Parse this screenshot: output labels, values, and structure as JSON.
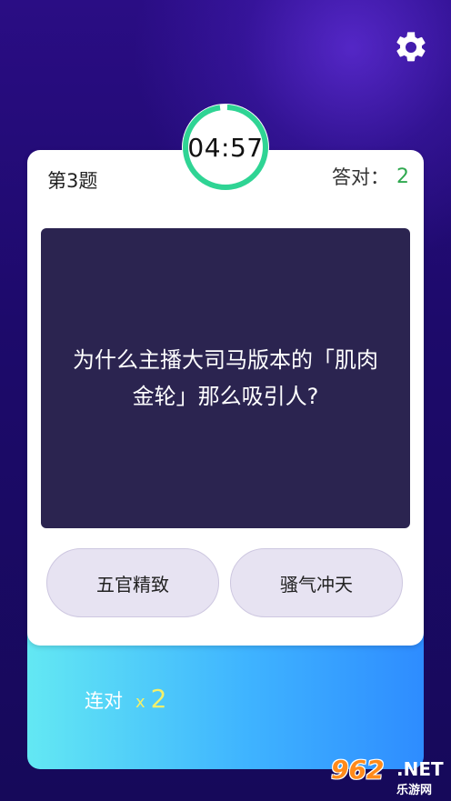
{
  "settings": {
    "icon": "gear-icon"
  },
  "timer": {
    "value": "04:57",
    "ring_color": "#2fd494"
  },
  "header": {
    "question_number": "第3题",
    "score_label": "答对：",
    "score_value": "2"
  },
  "question": {
    "text": "为什么主播大司马版本的「肌肉金轮」那么吸引人?"
  },
  "options": [
    {
      "label": "五官精致"
    },
    {
      "label": "骚气冲天"
    }
  ],
  "streak": {
    "label": "连对",
    "multiplier_prefix": "x",
    "value": "2"
  },
  "watermark": {
    "logo": "962",
    "suffix": ".NET",
    "sub": "乐游网"
  },
  "colors": {
    "background": "#1d0a6b",
    "question_bg": "#2b2450",
    "accent_green": "#2fa84f",
    "streak_yellow": "#f3f06a"
  }
}
